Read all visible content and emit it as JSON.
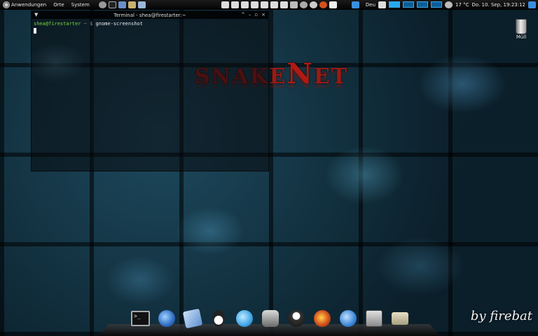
{
  "top_panel": {
    "menu": [
      "Anwendungen",
      "Orte",
      "System"
    ],
    "launcher_icons": [
      "search-icon",
      "terminal-icon",
      "browser-icon",
      "editor-icon",
      "cube-icon"
    ],
    "tray_icons": [
      "folder-icon",
      "folder-icon",
      "folder-icon",
      "folder-icon",
      "folder-icon",
      "folder-icon",
      "folder-icon",
      "folder-icon",
      "network-icon",
      "volume-icon",
      "firefox-icon",
      "chat-icon",
      "dropbox-icon"
    ],
    "keyboard_layout": "Deu",
    "weather": "17 °C",
    "datetime": "Do. 10. Sep, 19:23:12"
  },
  "terminal": {
    "title": "Terminal - shea@firestarter:~",
    "menu_glyph": "▼",
    "controls": [
      "^",
      "–",
      "▫",
      "×"
    ],
    "prompt_user": "shea@firestarter",
    "prompt_path": "~ $",
    "command": "gnome-screenshot"
  },
  "wallpaper": {
    "logo_text_1": "SNAKE",
    "logo_text_2": "N",
    "logo_text_3": "ET",
    "signature": "by firebat"
  },
  "desktop": {
    "trash_label": "Müll"
  },
  "dock": {
    "items": [
      {
        "name": "terminal-icon",
        "color": "#1a1a1a"
      },
      {
        "name": "thunderbird-icon",
        "color": "#2f6cc4"
      },
      {
        "name": "mail-icon",
        "color": "#5c8fd0"
      },
      {
        "name": "tux-icon",
        "color": "#dddddd"
      },
      {
        "name": "chat-bird-icon",
        "color": "#3fa6e6"
      },
      {
        "name": "webcam-icon",
        "color": "#8a8a8a"
      },
      {
        "name": "inkscape-icon",
        "color": "#333333"
      },
      {
        "name": "firefox-icon",
        "color": "#d2501e"
      },
      {
        "name": "chat-bubble-icon",
        "color": "#3b86d8"
      },
      {
        "name": "filezilla-icon",
        "color": "#b2b2b2"
      },
      {
        "name": "folder-icon",
        "color": "#c9c2a8"
      }
    ],
    "terminal_glyph": ">_"
  }
}
